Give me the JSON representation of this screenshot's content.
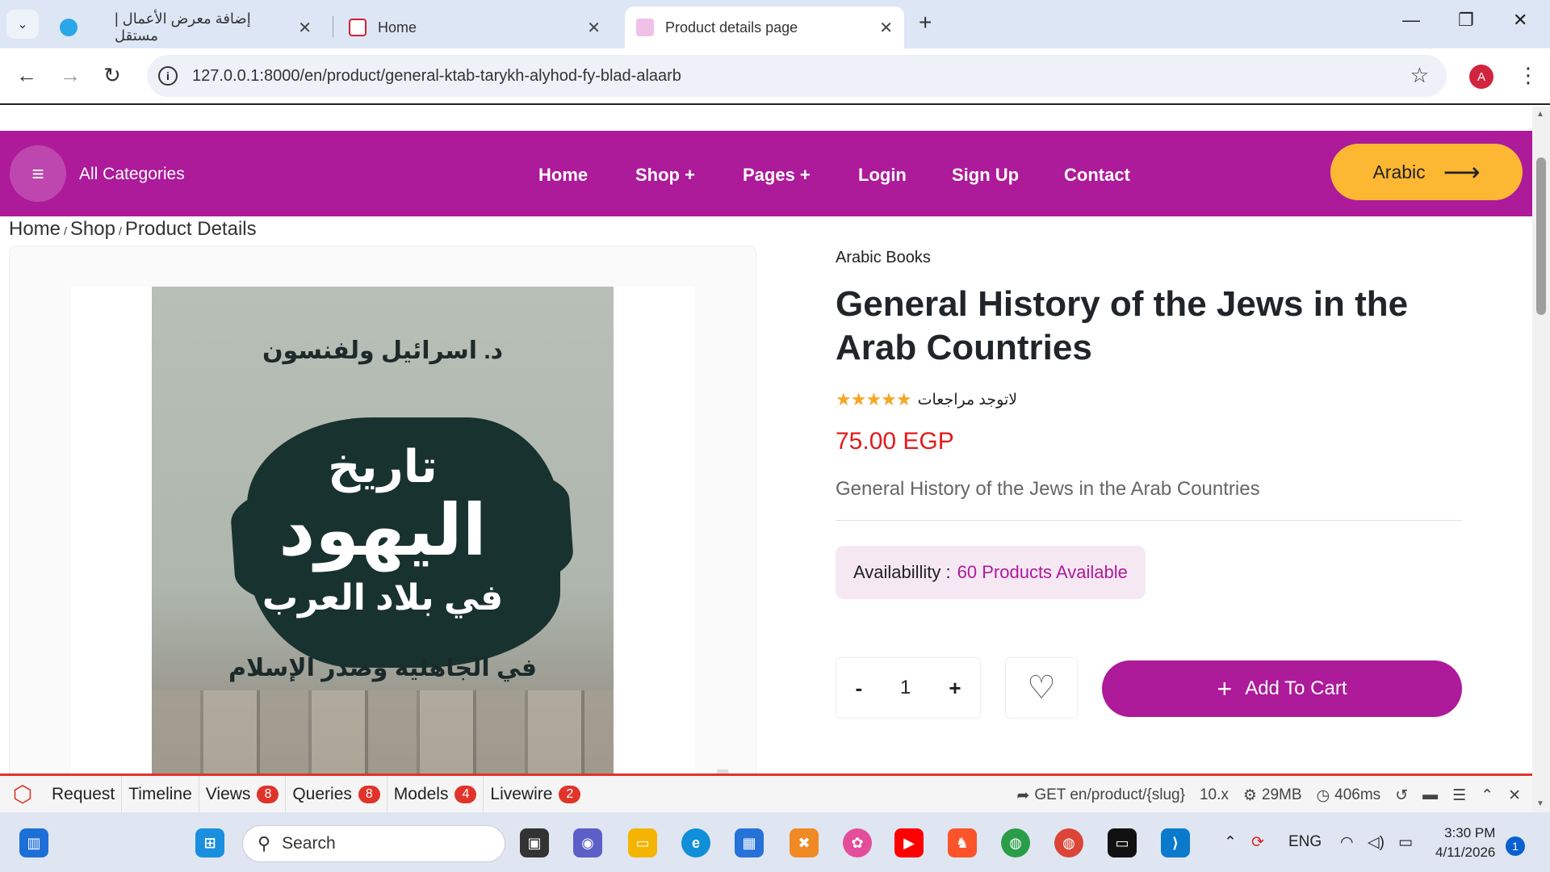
{
  "browser": {
    "tabs": [
      {
        "title": "إضافة معرض الأعمال | مستقل",
        "active": false
      },
      {
        "title": "Home",
        "active": false
      },
      {
        "title": "Product details page",
        "active": true
      }
    ],
    "url": "127.0.0.1:8000/en/product/general-ktab-tarykh-alyhod-fy-blad-alaarb",
    "profile_initial": "A"
  },
  "site": {
    "categories_label": "All Categories",
    "nav": [
      "Home",
      "Shop +",
      "Pages +",
      "Login",
      "Sign Up",
      "Contact"
    ],
    "language_button": "Arabic",
    "accent_color": "#ad1a9a",
    "button_color": "#fdb833"
  },
  "breadcrumb": [
    "Home",
    "Shop",
    "Product Details"
  ],
  "product": {
    "category": "Arabic Books",
    "title": "General History of the Jews in the Arab Countries",
    "stars": "★★★★★",
    "reviews_text": "لاتوجد مراجعات",
    "price": "75.00 EGP",
    "description": "General History of the Jews in the Arab Countries",
    "availability_label": "Availabillity :",
    "availability_value": "60 Products Available",
    "quantity": "1",
    "add_to_cart": "Add To Cart",
    "cover": {
      "author": "د. اسرائيل ولفنسون",
      "title_line1": "تاريخ",
      "title_line2": "اليهود",
      "title_line3": "في بلاد العرب",
      "subtitle": "في الجاهلية وصدر الإسلام"
    }
  },
  "watermark": "مستقل",
  "debugbar": {
    "items": [
      {
        "label": "Request",
        "badge": ""
      },
      {
        "label": "Timeline",
        "badge": ""
      },
      {
        "label": "Views",
        "badge": "8"
      },
      {
        "label": "Queries",
        "badge": "8"
      },
      {
        "label": "Models",
        "badge": "4"
      },
      {
        "label": "Livewire",
        "badge": "2"
      }
    ],
    "route": "GET en/product/{slug}",
    "version": "10.x",
    "memory": "29MB",
    "time": "406ms"
  },
  "taskbar": {
    "search_placeholder": "Search",
    "language": "ENG",
    "time": "3:30 PM",
    "date": "4/11/2026",
    "notifications": "1"
  }
}
